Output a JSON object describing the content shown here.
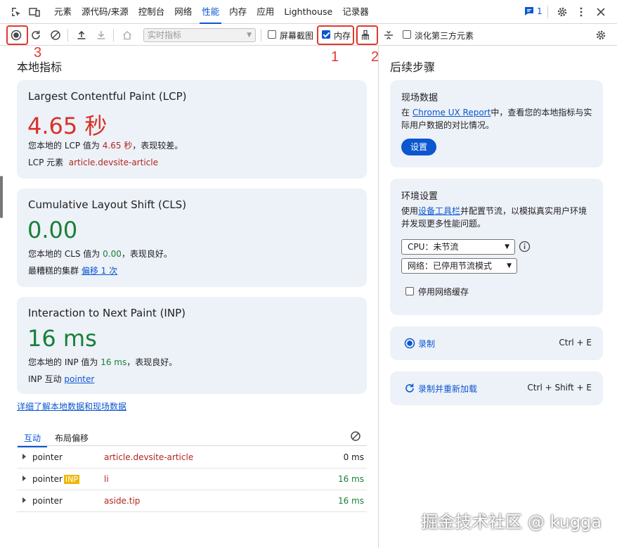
{
  "tabbar": {
    "tabs": [
      "元素",
      "源代码/来源",
      "控制台",
      "网络",
      "性能",
      "内存",
      "应用",
      "Lighthouse",
      "记录器"
    ],
    "active_tab": "性能",
    "issues_count": "1"
  },
  "toolbar": {
    "throttle_select": "实时指标",
    "screenshot_label": "屏幕截图",
    "memory_label": "内存",
    "memory_checked": true,
    "dim_third_party_label": "淡化第三方元素",
    "annotation_1": "1",
    "annotation_2": "2",
    "annotation_3": "3"
  },
  "local_metrics": {
    "heading": "本地指标",
    "lcp": {
      "title": "Largest Contentful Paint (LCP)",
      "value": "4.65 秒",
      "desc_prefix": "您本地的 LCP 值为 ",
      "desc_value": "4.65 秒",
      "desc_suffix": "，表现较差。",
      "element_label": "LCP 元素",
      "element_value": "article.devsite-article"
    },
    "cls": {
      "title": "Cumulative Layout Shift (CLS)",
      "value": "0.00",
      "desc_prefix": "您本地的 CLS 值为 ",
      "desc_value": "0.00",
      "desc_suffix": "，表现良好。",
      "cluster_label": "最糟糕的集群",
      "cluster_link": "偏移 1 次"
    },
    "inp": {
      "title": "Interaction to Next Paint (INP)",
      "value": "16 ms",
      "desc_prefix": "您本地的 INP 值为 ",
      "desc_value": "16 ms",
      "desc_suffix": "，表现良好。",
      "interaction_label": "INP 互动",
      "interaction_link": "pointer"
    },
    "learn_more_link": "详细了解本地数据和现场数据"
  },
  "interactions": {
    "tabs": [
      "互动",
      "布局偏移"
    ],
    "rows": [
      {
        "name": "pointer",
        "badge": "",
        "element": "article.devsite-article",
        "ms": "0 ms"
      },
      {
        "name": "pointer",
        "badge": "INP",
        "element": "li",
        "ms": "16 ms"
      },
      {
        "name": "pointer",
        "badge": "",
        "element": "aside.tip",
        "ms": "16 ms"
      }
    ]
  },
  "next_steps": {
    "heading": "后续步骤",
    "field_data": {
      "title": "现场数据",
      "text_prefix": "在 ",
      "text_link": "Chrome UX Report",
      "text_suffix": "中，查看您的本地指标与实际用户数据的对比情况。",
      "button": "设置"
    },
    "env": {
      "title": "环境设置",
      "text_prefix": "使用",
      "text_link": "设备工具栏",
      "text_suffix": "并配置节流，以模拟真实用户环境并发现更多性能问题。",
      "cpu_select": "CPU：未节流",
      "network_select": "网络：已停用节流模式",
      "disable_cache_label": "停用网络缓存"
    },
    "record": {
      "label": "录制",
      "shortcut": "Ctrl + E"
    },
    "record_reload": {
      "label": "录制并重新加载",
      "shortcut": "Ctrl + Shift + E"
    }
  },
  "watermark": "掘金技术社区 @ kugga",
  "colors": {
    "accent": "#0b57d0",
    "poor": "#d93025",
    "good": "#188038",
    "annotation": "#e03a2f"
  }
}
